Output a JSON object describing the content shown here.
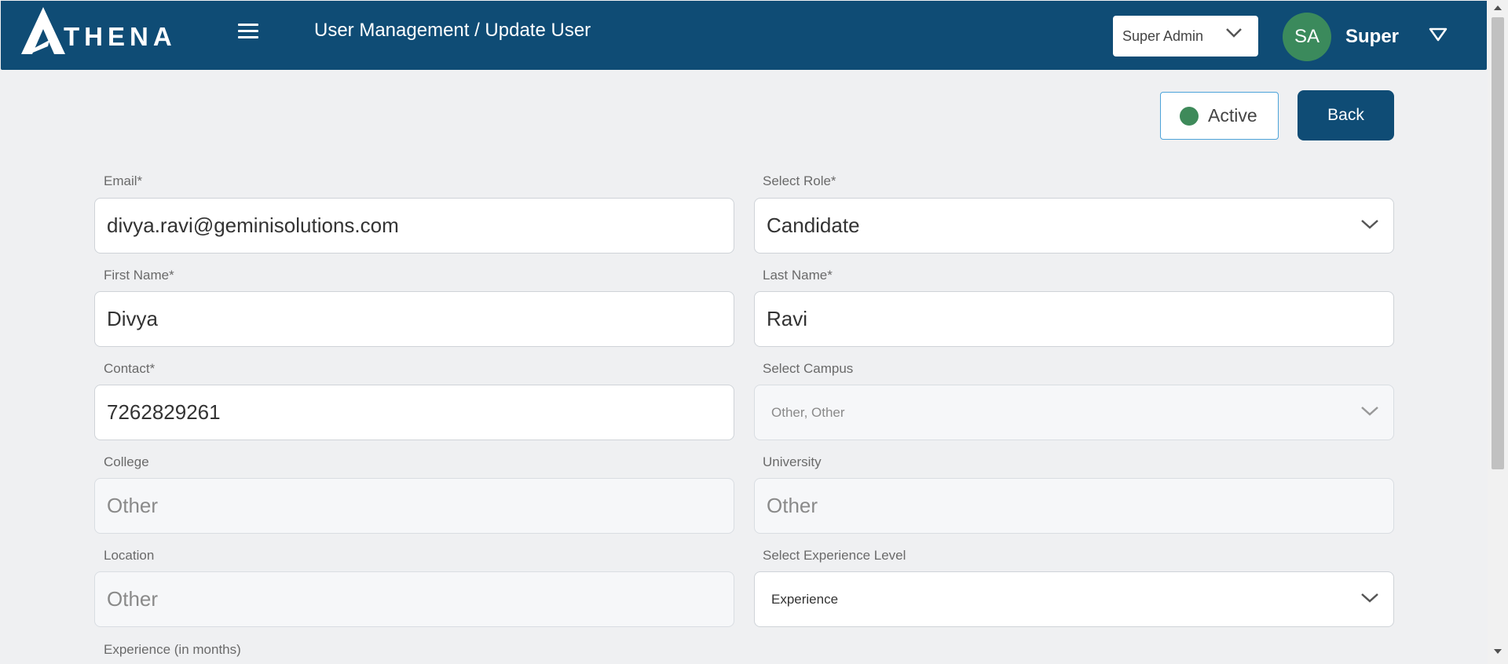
{
  "header": {
    "logo_text": "THENA",
    "breadcrumb": "User Management / Update User",
    "role_selector": "Super Admin",
    "avatar_initials": "SA",
    "user_name": "Super"
  },
  "actions": {
    "status_label": "Active",
    "back_label": "Back"
  },
  "form": {
    "email": {
      "label": "Email*",
      "value": "divya.ravi@geminisolutions.com"
    },
    "role": {
      "label": "Select Role*",
      "value": "Candidate"
    },
    "first_name": {
      "label": "First Name*",
      "value": "Divya"
    },
    "last_name": {
      "label": "Last Name*",
      "value": "Ravi"
    },
    "contact": {
      "label": "Contact*",
      "value": "7262829261"
    },
    "campus": {
      "label": "Select Campus",
      "value": "Other, Other"
    },
    "college": {
      "label": "College",
      "value": "Other"
    },
    "university": {
      "label": "University",
      "value": "Other"
    },
    "location": {
      "label": "Location",
      "value": "Other"
    },
    "experience_level": {
      "label": "Select Experience Level",
      "value": "Experience"
    },
    "experience_months": {
      "label": "Experience (in months)"
    }
  },
  "colors": {
    "header_bg": "#0f4c75",
    "active_dot": "#3e8a5a",
    "avatar_bg": "#3b8a5c",
    "page_bg": "#eff0f2"
  }
}
